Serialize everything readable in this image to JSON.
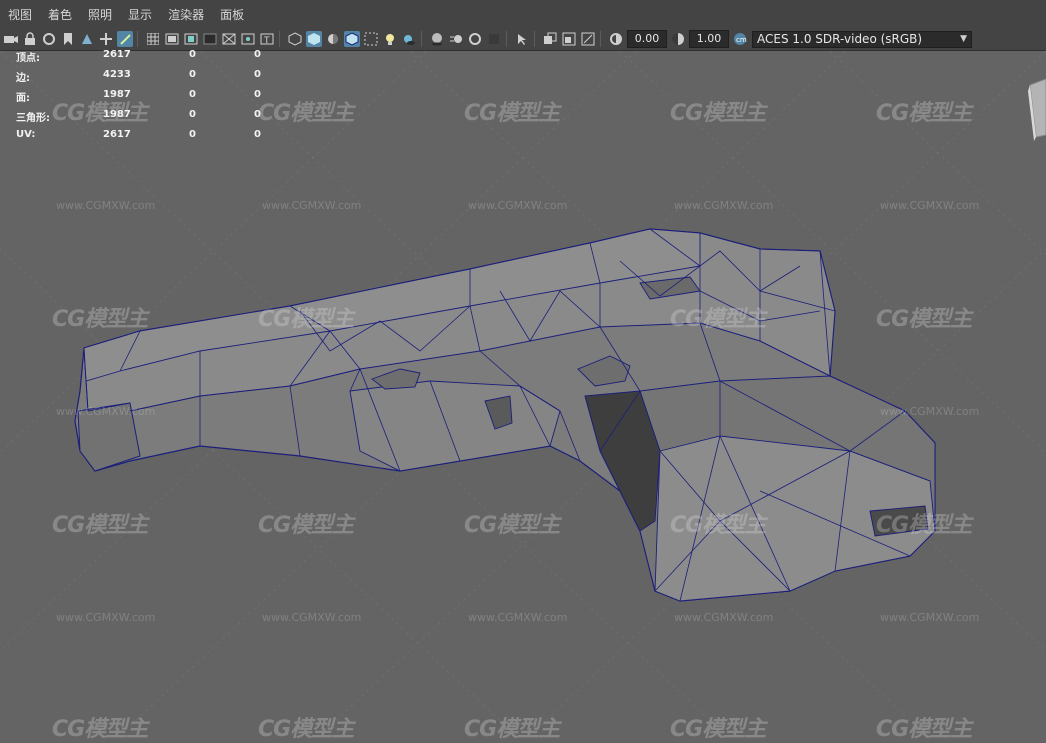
{
  "menubar": {
    "items": [
      "视图",
      "着色",
      "照明",
      "显示",
      "渲染器",
      "面板"
    ]
  },
  "toolbar": {
    "near_clip": "0.00",
    "gamma": "1.00",
    "color_management": "ACES 1.0 SDR-video (sRGB)",
    "icons": [
      "camera-icon",
      "lock-camera-icon",
      "camera-attributes-icon",
      "bookmark-icon",
      "image-plane-icon",
      "2d-pan-icon",
      "grease-pencil-icon",
      "grid-icon",
      "film-gate-icon",
      "resolution-gate-icon",
      "gate-mask-icon",
      "field-chart-icon",
      "safe-action-icon",
      "safe-title-icon",
      "wireframe-icon",
      "smooth-shade-icon",
      "default-material-icon",
      "wireframe-on-shaded-icon",
      "xray-icon",
      "use-all-lights-icon",
      "shadows-icon",
      "screen-space-ao-icon",
      "motion-blur-icon",
      "anti-aliasing-icon",
      "depth-of-field-icon",
      "isolate-select-icon",
      "xray-joints-icon",
      "xray-active-icon",
      "exposure-icon",
      "gamma-icon",
      "color-management-icon"
    ]
  },
  "hud": {
    "rows": [
      {
        "label": "顶点:",
        "v1": "2617",
        "v2": "0",
        "v3": "0"
      },
      {
        "label": "边:",
        "v1": "4233",
        "v2": "0",
        "v3": "0"
      },
      {
        "label": "面:",
        "v1": "1987",
        "v2": "0",
        "v3": "0"
      },
      {
        "label": "三角形:",
        "v1": "1987",
        "v2": "0",
        "v3": "0"
      },
      {
        "label": "UV:",
        "v1": "2617",
        "v2": "0",
        "v3": "0"
      }
    ]
  },
  "watermark": {
    "logo": "CG模型主",
    "url": "www.CGMXW.com"
  },
  "colors": {
    "viewport_bg": "#646464",
    "wire": "#1b1f7a",
    "accent": "#5285a6"
  }
}
